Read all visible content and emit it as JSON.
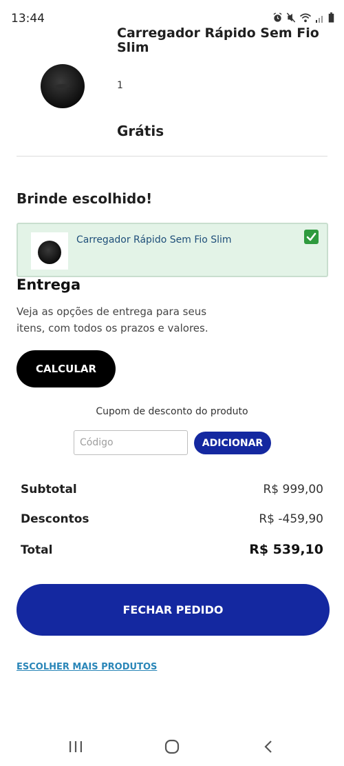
{
  "status_bar": {
    "time": "13:44",
    "icons": [
      "alarm-icon",
      "mute-icon",
      "wifi-icon",
      "signal-icon",
      "battery-icon"
    ]
  },
  "product": {
    "name": "Carregador Rápido Sem Fio Slim",
    "quantity": "1",
    "price": "Grátis",
    "image_icon": "wireless-charger-icon"
  },
  "gift": {
    "heading": "Brinde escolhido!",
    "item_name": "Carregador Rápido Sem Fio Slim",
    "selected": true,
    "check_color": "#2e9a3e",
    "card_color": "#e3f3e7"
  },
  "delivery": {
    "heading": "Entrega",
    "description": "Veja as opções de entrega para seus itens, com todos os prazos e valores.",
    "calculate_label": "CALCULAR"
  },
  "coupon": {
    "label": "Cupom de desconto do produto",
    "placeholder": "Código",
    "value": "",
    "add_label": "ADICIONAR"
  },
  "summary": {
    "subtotal_label": "Subtotal",
    "subtotal_value": "R$ 999,00",
    "discounts_label": "Descontos",
    "discounts_value": "R$ -459,90",
    "total_label": "Total",
    "total_value": "R$ 539,10"
  },
  "actions": {
    "checkout_label": "FECHAR PEDIDO",
    "more_products_label": "ESCOLHER MAIS PRODUTOS"
  },
  "colors": {
    "primary_blue": "#1428a0",
    "link_blue": "#2a86b8"
  },
  "nav_bar": {
    "icons": [
      "recent-apps-icon",
      "home-icon",
      "back-icon"
    ]
  }
}
